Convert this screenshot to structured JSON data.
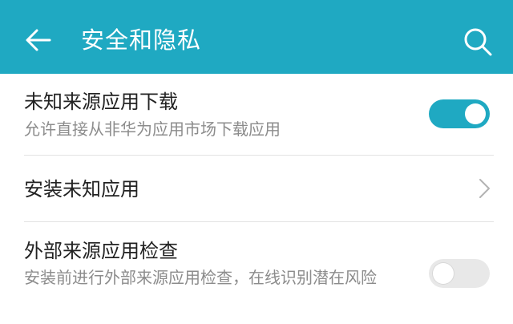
{
  "header": {
    "title": "安全和隐私",
    "background_color": "#1fa9c2",
    "back_icon": "arrow-left-icon",
    "search_icon": "search-icon"
  },
  "settings": {
    "unknown_source_download": {
      "title": "未知来源应用下载",
      "subtitle": "允许直接从非华为应用市场下载应用",
      "enabled": true
    },
    "install_unknown_apps": {
      "title": "安装未知应用",
      "icon": "chevron-right-icon"
    },
    "external_source_check": {
      "title": "外部来源应用检查",
      "subtitle": "安装前进行外部来源应用检查，在线识别潜在风险",
      "enabled": false
    }
  },
  "colors": {
    "accent": "#1fa9c2",
    "toggle_off": "#e8e8e8"
  }
}
